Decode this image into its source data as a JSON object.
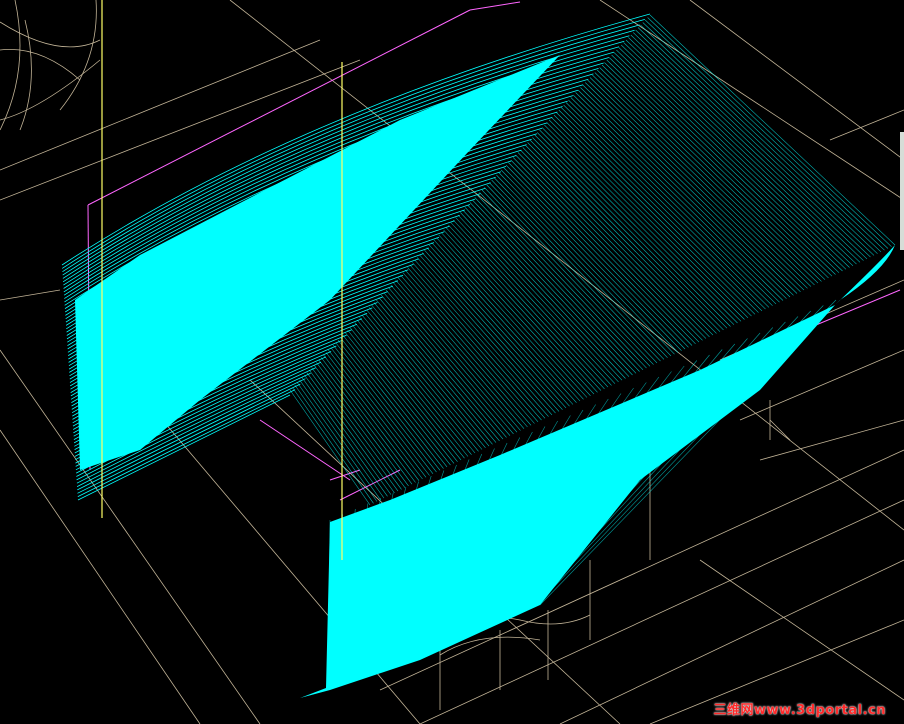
{
  "viewport": {
    "background": "#000000",
    "surface_color": "#00ffff",
    "guide_color": "#ffff66",
    "edge_color": "#ff66ff",
    "construction_color": "#d8c8a8",
    "scroll_indicator_color": "#d7ddd7"
  },
  "watermark": {
    "cn_text": "三维网",
    "site": "www.3dportal.cn",
    "color": "#ff2a2a"
  }
}
